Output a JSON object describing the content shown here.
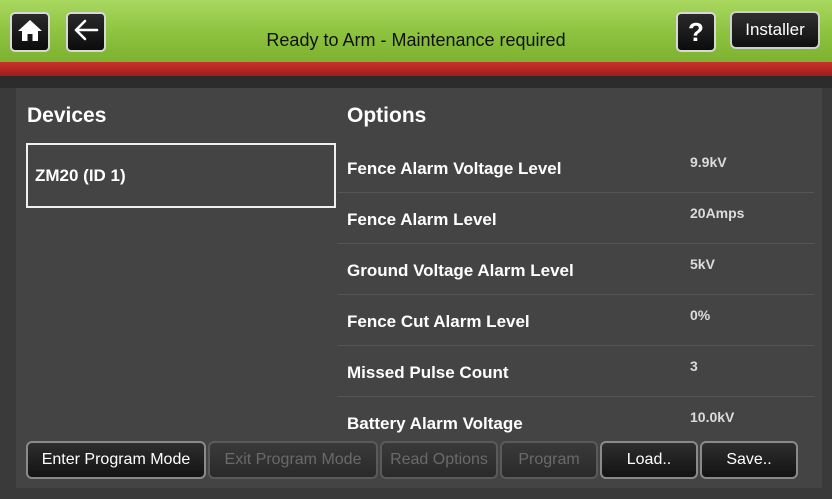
{
  "header": {
    "status": "Ready to Arm - Maintenance required",
    "help_glyph": "?",
    "installer_label": "Installer",
    "icons": [
      "home-icon",
      "back-arrow-icon",
      "help-icon"
    ],
    "colors": {
      "green": "#8cc23e",
      "red": "#b02420",
      "background": "#444444"
    }
  },
  "devices": {
    "title": "Devices",
    "items": [
      {
        "label": "ZM20 (ID 1)"
      }
    ]
  },
  "options": {
    "title": "Options",
    "rows": [
      {
        "label": "Fence Alarm Voltage Level",
        "value": "9.9kV"
      },
      {
        "label": "Fence Alarm Level",
        "value": "20Amps"
      },
      {
        "label": "Ground Voltage Alarm Level",
        "value": "5kV"
      },
      {
        "label": "Fence Cut Alarm Level",
        "value": "0%"
      },
      {
        "label": "Missed Pulse Count",
        "value": "3"
      },
      {
        "label": "Battery Alarm Voltage",
        "value": "10.0kV"
      }
    ]
  },
  "buttons": {
    "enter_program_mode": "Enter Program Mode",
    "exit_program_mode": "Exit Program Mode",
    "read_options": "Read Options",
    "program": "Program",
    "load": "Load..",
    "save": "Save.."
  }
}
